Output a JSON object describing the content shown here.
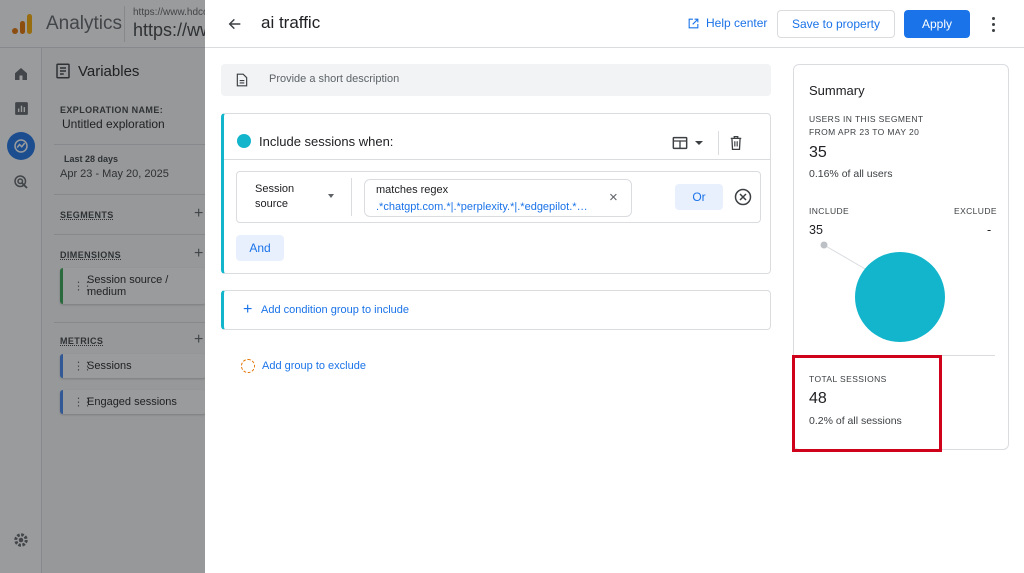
{
  "background": {
    "app_title": "Analytics",
    "property_url_small": "https://www.hdco",
    "property_url_big": "https://www",
    "variables_title": "Variables",
    "exploration_name_label": "EXPLORATION NAME:",
    "exploration_name": "Untitled exploration",
    "date_label": "Last 28 days",
    "date_range": "Apr 23 - May 20, 2025",
    "segments_label": "SEGMENTS",
    "dimensions_label": "DIMENSIONS",
    "dimension_chip": "Session source / medium",
    "metrics_label": "METRICS",
    "metric_1": "Sessions",
    "metric_2": "Engaged sessions"
  },
  "dialog": {
    "title": "ai traffic",
    "help_label": "Help center",
    "save_label": "Save to property",
    "apply_label": "Apply",
    "description_placeholder": "Provide a short description"
  },
  "condition_group": {
    "include_label": "Include sessions when:",
    "dimension_line1": "Session",
    "dimension_line2": "source",
    "operator": "matches regex",
    "value": ".*chatgpt.com.*|.*perplexity.*|.*edgepilot.*…",
    "or_label": "Or",
    "and_label": "And",
    "clear_glyph": "×"
  },
  "add_group_label": "Add condition group to include",
  "add_group_plus": "+",
  "add_exclude_label": "Add group to exclude",
  "summary": {
    "title": "Summary",
    "users_caption_line1": "USERS IN THIS SEGMENT",
    "users_caption_line2": "FROM APR 23 TO MAY 20",
    "users_value": "35",
    "users_sub": "0.16% of all users",
    "include_label": "INCLUDE",
    "exclude_label": "EXCLUDE",
    "include_value": "35",
    "exclude_value": "-",
    "sessions_caption": "TOTAL SESSIONS",
    "sessions_value": "48",
    "sessions_sub": "0.2% of all sessions",
    "pie_color": "#12b5cb",
    "highlight_color": "#d0021b"
  }
}
